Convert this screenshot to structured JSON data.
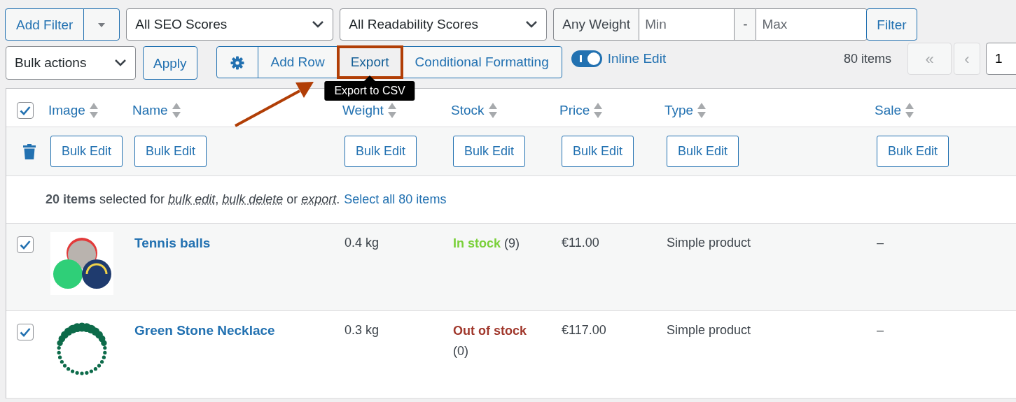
{
  "filters": {
    "add_filter": "Add Filter",
    "seo_select": "All SEO Scores",
    "readability_select": "All Readability Scores",
    "weight": {
      "label": "Any Weight",
      "min_placeholder": "Min",
      "separator": "-",
      "max_placeholder": "Max"
    },
    "filter_button": "Filter"
  },
  "toolbar": {
    "bulk_actions": "Bulk actions",
    "apply": "Apply",
    "group": [
      {
        "kind": "settings",
        "highlighted": false
      },
      {
        "kind": "text",
        "label": "Add Row",
        "highlighted": false
      },
      {
        "kind": "text",
        "label": "Export",
        "highlighted": true,
        "tooltip": "Export to CSV"
      },
      {
        "kind": "text",
        "label": "Conditional Formatting",
        "highlighted": false
      }
    ],
    "inline_edit": {
      "label": "Inline Edit",
      "on": true
    },
    "pagination": {
      "count": "80 items",
      "first": {
        "label": "«",
        "disabled": true
      },
      "prev": {
        "label": "‹",
        "disabled": true
      },
      "page": "1"
    }
  },
  "table": {
    "select_all": true,
    "columns": [
      {
        "label": "Image",
        "bulk_edit": "Bulk Edit"
      },
      {
        "label": "Name",
        "bulk_edit": "Bulk Edit"
      },
      {
        "label": "Weight",
        "bulk_edit": "Bulk Edit"
      },
      {
        "label": "Stock",
        "bulk_edit": "Bulk Edit"
      },
      {
        "label": "Price",
        "bulk_edit": "Bulk Edit"
      },
      {
        "label": "Type",
        "bulk_edit": "Bulk Edit"
      },
      {
        "label": "Sale",
        "bulk_edit": "Bulk Edit"
      }
    ],
    "selection_message": "**20 items** selected for *bulk edit*, *bulk delete* or *export*.",
    "select_all_link": "Select all 80 items",
    "rows": [
      {
        "selected": true,
        "name": "Tennis balls",
        "weight": "0.4 kg",
        "in_stock": true,
        "stock_label": "In stock",
        "stock_count": "(9)",
        "price": "€11.00",
        "type": "Simple product",
        "sale": "–"
      },
      {
        "selected": true,
        "name": "Green Stone Necklace",
        "weight": "0.3 kg",
        "in_stock": false,
        "stock_label": "Out of stock",
        "stock_count": "(0)",
        "price": "€117.00",
        "type": "Simple product",
        "sale": "–"
      }
    ]
  }
}
